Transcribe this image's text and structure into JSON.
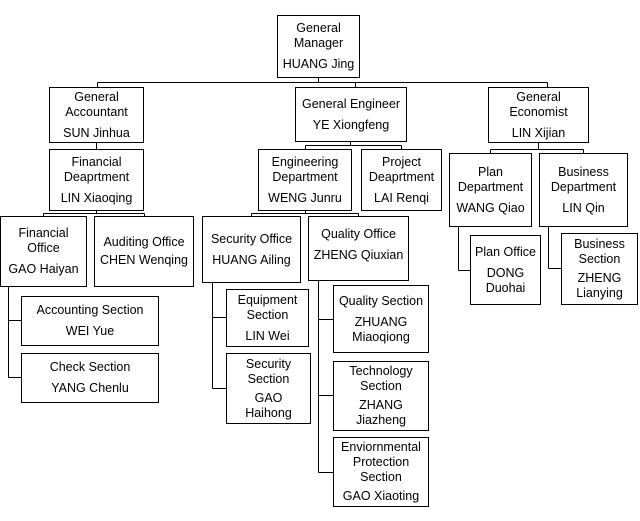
{
  "nodes": {
    "gm": {
      "title": "General Manager",
      "name": "HUANG Jing"
    },
    "ga": {
      "title": "General Accountant",
      "name": "SUN Jinhua"
    },
    "ge": {
      "title": "General Engineer",
      "name": "YE Xiongfeng"
    },
    "gec": {
      "title": "General Economist",
      "name": "LIN Xijian"
    },
    "fin_dept": {
      "title": "Financial Deaprtment",
      "name": "LIN Xiaoqing"
    },
    "eng_dept": {
      "title": "Engineering Department",
      "name": "WENG Junru"
    },
    "proj_dept": {
      "title": "Project Deaprtment",
      "name": "LAI Renqi"
    },
    "plan_dept": {
      "title": "Plan Department",
      "name": "WANG Qiao"
    },
    "biz_dept": {
      "title": "Business Department",
      "name": "LIN Qin"
    },
    "fin_office": {
      "title": "Financial Office",
      "name": "GAO Haiyan"
    },
    "audit_office": {
      "title": "Auditing Office",
      "name": "CHEN Wenqing"
    },
    "sec_office": {
      "title": "Security Office",
      "name": "HUANG Ailing"
    },
    "qual_office": {
      "title": "Quality Office",
      "name": "ZHENG Qiuxian"
    },
    "plan_office": {
      "title": "Plan Office",
      "name": "DONG Duohai"
    },
    "biz_section": {
      "title": "Business Section",
      "name": "ZHENG Lianying"
    },
    "acct_section": {
      "title": "Accounting Section",
      "name": "WEI Yue"
    },
    "check_section": {
      "title": "Check Section",
      "name": "YANG Chenlu"
    },
    "equip_section": {
      "title": "Equipment Section",
      "name": "LIN Wei"
    },
    "secu_section": {
      "title": "Security Section",
      "name": "GAO Haihong"
    },
    "qual_section": {
      "title": "Quality Section",
      "name": "ZHUANG Miaoqiong"
    },
    "tech_section": {
      "title": "Technology Section",
      "name": "ZHANG Jiazheng"
    },
    "env_section": {
      "title": "Enviornmental Protection Section",
      "name": "GAO Xiaoting"
    }
  },
  "edges": [
    [
      "gm",
      "ga"
    ],
    [
      "gm",
      "ge"
    ],
    [
      "gm",
      "gec"
    ],
    [
      "ga",
      "fin_dept"
    ],
    [
      "fin_dept",
      "fin_office"
    ],
    [
      "fin_dept",
      "audit_office"
    ],
    [
      "fin_office",
      "acct_section"
    ],
    [
      "fin_office",
      "check_section"
    ],
    [
      "ge",
      "eng_dept"
    ],
    [
      "ge",
      "proj_dept"
    ],
    [
      "eng_dept",
      "sec_office"
    ],
    [
      "eng_dept",
      "qual_office"
    ],
    [
      "sec_office",
      "equip_section"
    ],
    [
      "sec_office",
      "secu_section"
    ],
    [
      "qual_office",
      "qual_section"
    ],
    [
      "qual_office",
      "tech_section"
    ],
    [
      "qual_office",
      "env_section"
    ],
    [
      "gec",
      "plan_dept"
    ],
    [
      "gec",
      "biz_dept"
    ],
    [
      "plan_dept",
      "plan_office"
    ],
    [
      "biz_dept",
      "biz_section"
    ]
  ]
}
